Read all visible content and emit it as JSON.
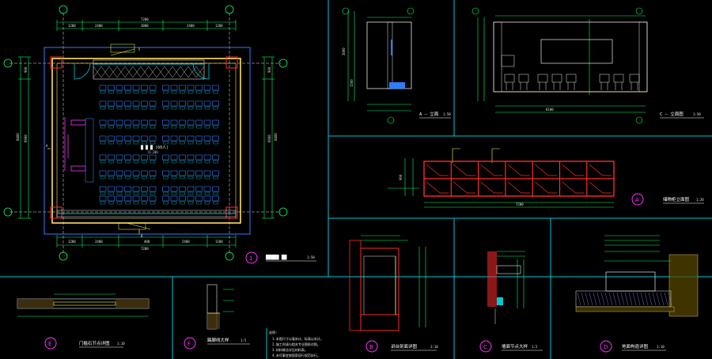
{
  "colors": {
    "background": "#000000",
    "frame": "#00c8d8",
    "grid": "#e8e8e8",
    "dim": "#00ff66",
    "wall": "#ffe066",
    "desk": "#2e7dff",
    "marker": "#ff33ff",
    "cabinet": "#ff2a2a",
    "hatch": "#9a8cff",
    "accent": "#ffff33"
  },
  "plan": {
    "callout": "1",
    "title_box": "█████ ██",
    "title_scale": "1:50",
    "room_label": "█ █ █ (60人)",
    "room_sub": "(1:20)",
    "axis_a": "A",
    "axis_b": "B",
    "top_total": "7200",
    "bottom_total": "7200",
    "left_total": "8400",
    "top_dims": [
      "1200",
      "2400",
      "3000",
      "2400",
      "1200"
    ],
    "bottom_dims": [
      "1200",
      "2400",
      "400",
      "2400",
      "1100"
    ],
    "left_dims": [
      "900",
      "6900"
    ],
    "right_dims": [
      "900",
      "6900"
    ]
  },
  "elevation_a": {
    "label": "A — 立面",
    "scale": "1:50",
    "dims": [
      "3000",
      "1500"
    ]
  },
  "elevation_c": {
    "label": "C — 立面图",
    "scale": "1:50",
    "width": "8100"
  },
  "cabinet": {
    "callout": "A",
    "title": "储物柜立面图",
    "scale": "1:20",
    "width": "7200",
    "height": "900"
  },
  "detail_b": {
    "callout": "B",
    "title": "讲台剖面详图",
    "scale": "1:10"
  },
  "detail_c": {
    "callout": "C",
    "title": "墙面节点大样",
    "scale": "1:5"
  },
  "detail_d": {
    "callout": "D",
    "title": "地面构造详图",
    "scale": "1:10"
  },
  "detail_e": {
    "callout": "E",
    "title": "门槛石节点详图",
    "scale": "1:10"
  },
  "detail_f": {
    "callout": "F",
    "title": "踢脚线大样",
    "scale": "1:5"
  },
  "notes": {
    "heading": "说明:",
    "lines": [
      "1.本图尺寸以毫米计，标高以米计。",
      "2.施工时请与相关专业图纸对照。",
      "3.材料做法详见材料表。",
      "4.未尽事宜按国家现行规范执行。"
    ]
  }
}
